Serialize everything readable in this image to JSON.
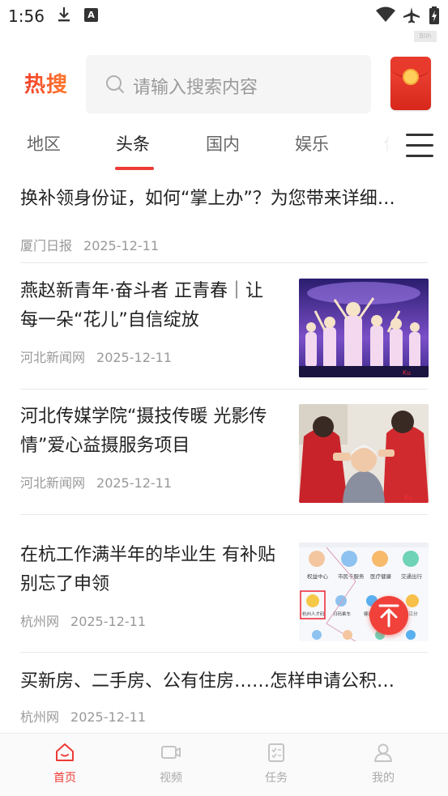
{
  "status_bar": {
    "time": "1:56",
    "icons": [
      "download-icon",
      "font-a-icon",
      "wifi-icon",
      "airplane-icon",
      "battery-charging-icon"
    ]
  },
  "watermark": "Blih",
  "header": {
    "logo_text": "热搜",
    "search_placeholder": "请输入搜索内容",
    "redpacket_icon": "red-packet-icon"
  },
  "tabs": [
    {
      "label": "地区",
      "active": false
    },
    {
      "label": "头条",
      "active": true
    },
    {
      "label": "国内",
      "active": false
    },
    {
      "label": "娱乐",
      "active": false
    },
    {
      "label": "体",
      "active": false
    }
  ],
  "news": [
    {
      "title": "换补领身份证，如何“掌上办”？为您带来详细…",
      "source": "厦门日报",
      "date": "2025-12-11",
      "has_image": false
    },
    {
      "title": "燕赵新青年·奋斗者 正青春｜让每一朵“花儿”自信绽放",
      "source": "河北新闻网",
      "date": "2025-12-11",
      "has_image": true
    },
    {
      "title": "河北传媒学院“摄技传暖 光影传情”爱心益摄服务项目",
      "source": "河北新闻网",
      "date": "2025-12-11",
      "has_image": true
    },
    {
      "title": "在杭工作满半年的毕业生 有补贴别忘了申领",
      "source": "杭州网",
      "date": "2025-12-11",
      "has_image": true
    },
    {
      "title": "买新房、二手房、公有住房……怎样申请公积…",
      "source": "杭州网",
      "date": "2025-12-11",
      "has_image": false
    }
  ],
  "thumb4_labels": {
    "a": "权益中心",
    "b": "市民卡服务",
    "c": "医疗健康",
    "d": "交通出行",
    "e": "杭州人才码",
    "f": "扫码乘车",
    "g": "健康码",
    "h": "钱江分"
  },
  "bottom_nav": [
    {
      "label": "首页",
      "icon": "home-icon",
      "active": true
    },
    {
      "label": "视频",
      "icon": "video-icon",
      "active": false
    },
    {
      "label": "任务",
      "icon": "task-icon",
      "active": false
    },
    {
      "label": "我的",
      "icon": "profile-icon",
      "active": false
    }
  ],
  "colors": {
    "accent": "#ee3b36",
    "text": "#222222",
    "meta": "#999999"
  }
}
